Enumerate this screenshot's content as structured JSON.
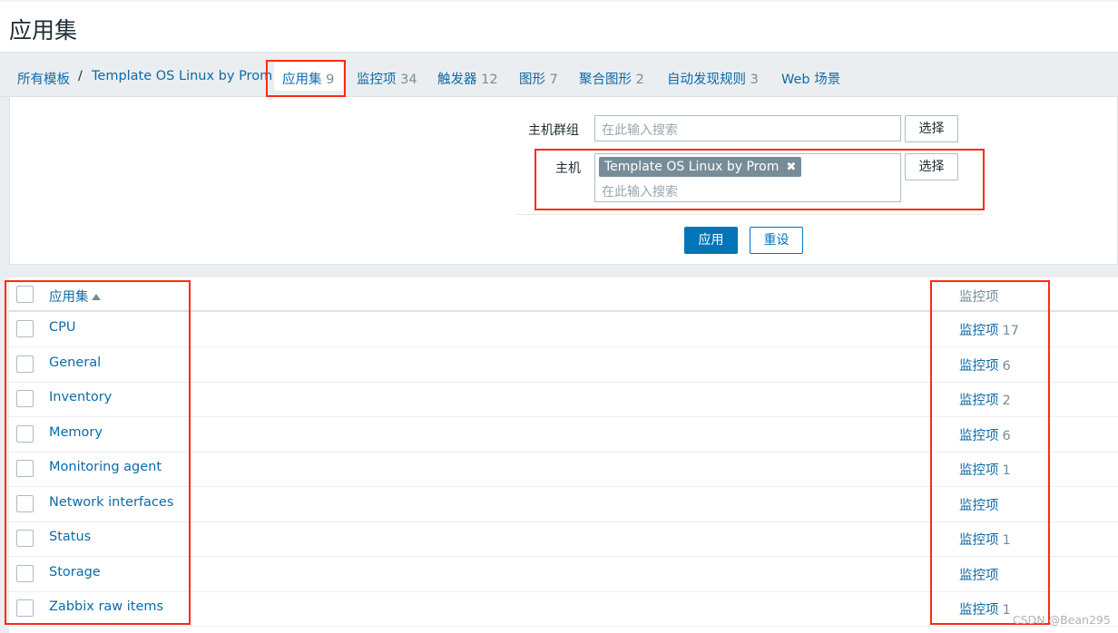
{
  "page": {
    "title": "应用集"
  },
  "nav": {
    "breadcrumb_root": "所有模板",
    "separator": "/",
    "template_name": "Template OS Linux by Prom",
    "tabs": [
      {
        "label": "应用集",
        "count": "9",
        "active": true
      },
      {
        "label": "监控项",
        "count": "34"
      },
      {
        "label": "触发器",
        "count": "12"
      },
      {
        "label": "图形",
        "count": "7"
      },
      {
        "label": "聚合图形",
        "count": "2"
      },
      {
        "label": "自动发现规则",
        "count": "3"
      },
      {
        "label": "Web 场景",
        "count": ""
      }
    ]
  },
  "filter": {
    "host_group_label": "主机群组",
    "host_group_placeholder": "在此输入搜索",
    "host_label": "主机",
    "host_chip": "Template OS Linux by Prom",
    "host_chip_remove_icon": "✖",
    "host_placeholder": "在此输入搜索",
    "select_label": "选择",
    "apply_label": "应用",
    "reset_label": "重设"
  },
  "table": {
    "columns": {
      "name": "应用集",
      "items": "监控项"
    },
    "item_link_label": "监控项",
    "rows": [
      {
        "name": "CPU",
        "items_count": "17"
      },
      {
        "name": "General",
        "items_count": "6"
      },
      {
        "name": "Inventory",
        "items_count": "2"
      },
      {
        "name": "Memory",
        "items_count": "6"
      },
      {
        "name": "Monitoring agent",
        "items_count": "1"
      },
      {
        "name": "Network interfaces",
        "items_count": ""
      },
      {
        "name": "Status",
        "items_count": "1"
      },
      {
        "name": "Storage",
        "items_count": ""
      },
      {
        "name": "Zabbix raw items",
        "items_count": "1"
      }
    ]
  },
  "annotation_color": "#ff2a10",
  "watermark": "CSDN @Bean295"
}
